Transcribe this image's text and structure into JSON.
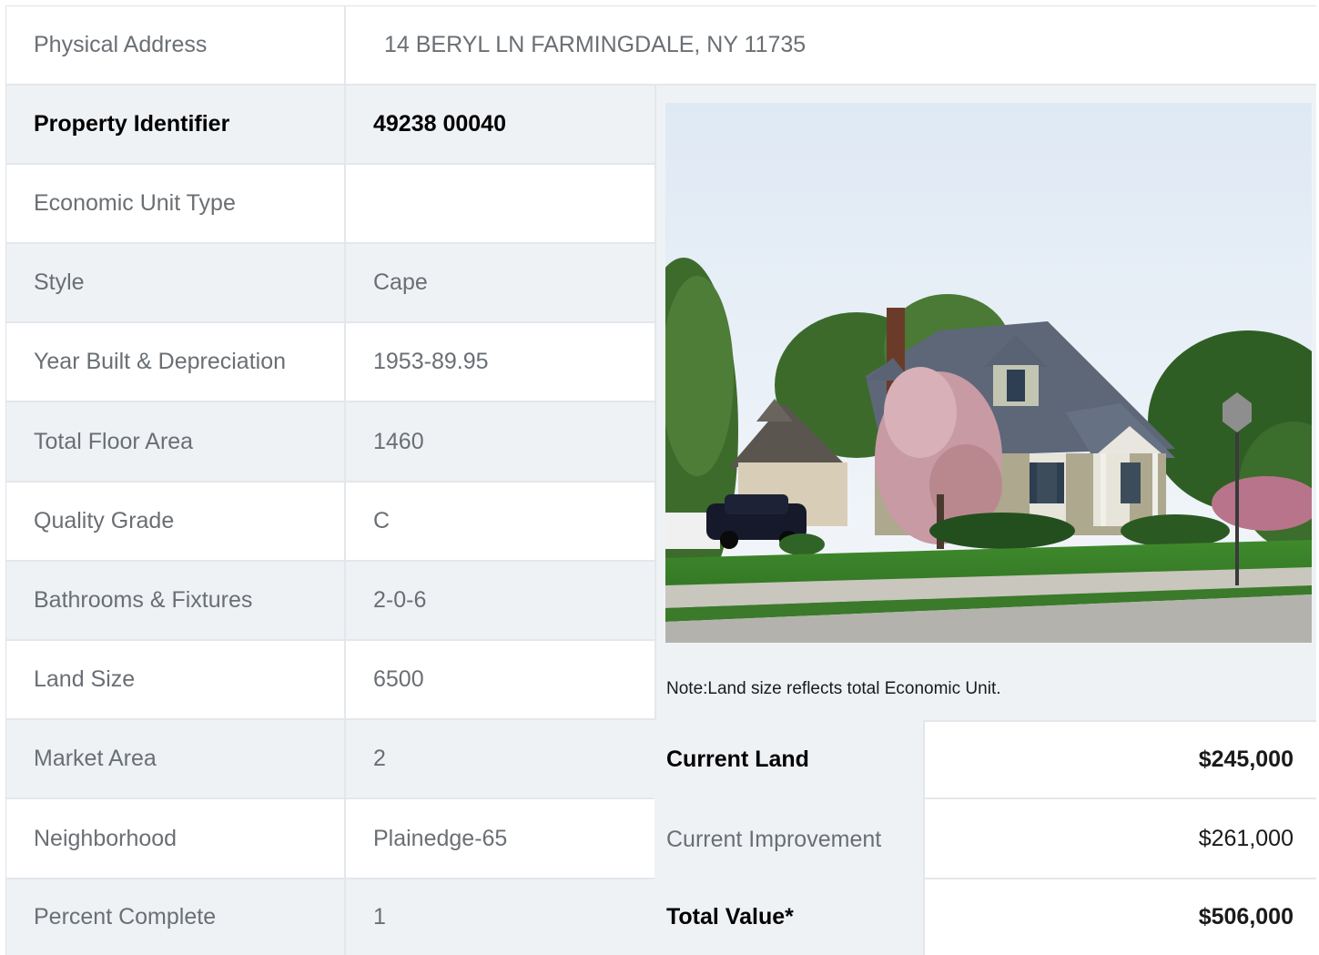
{
  "address": {
    "label": "Physical Address",
    "value": "14  BERYL LN  FARMINGDALE, NY  11735"
  },
  "rows": [
    {
      "label": "Property Identifier",
      "value": "49238  00040"
    },
    {
      "label": "Economic Unit Type",
      "value": ""
    },
    {
      "label": "Style",
      "value": "Cape"
    },
    {
      "label": "Year Built & Depreciation",
      "value": "1953-89.95"
    },
    {
      "label": "Total Floor Area",
      "value": "1460"
    },
    {
      "label": "Quality Grade",
      "value": "C"
    },
    {
      "label": "Bathrooms & Fixtures",
      "value": "2-0-6"
    },
    {
      "label": "Land Size",
      "value": "6500"
    },
    {
      "label": "Market Area",
      "value": "2"
    },
    {
      "label": "Neighborhood",
      "value": "Plainedge-65"
    },
    {
      "label": "Percent Complete",
      "value": "1"
    }
  ],
  "note": "Note:Land size reflects total Economic Unit.",
  "valuation": [
    {
      "label": "Current Land",
      "value": "$245,000"
    },
    {
      "label": "Current Improvement",
      "value": "$261,000"
    },
    {
      "label": "Total Value*",
      "value": "$506,000"
    }
  ]
}
